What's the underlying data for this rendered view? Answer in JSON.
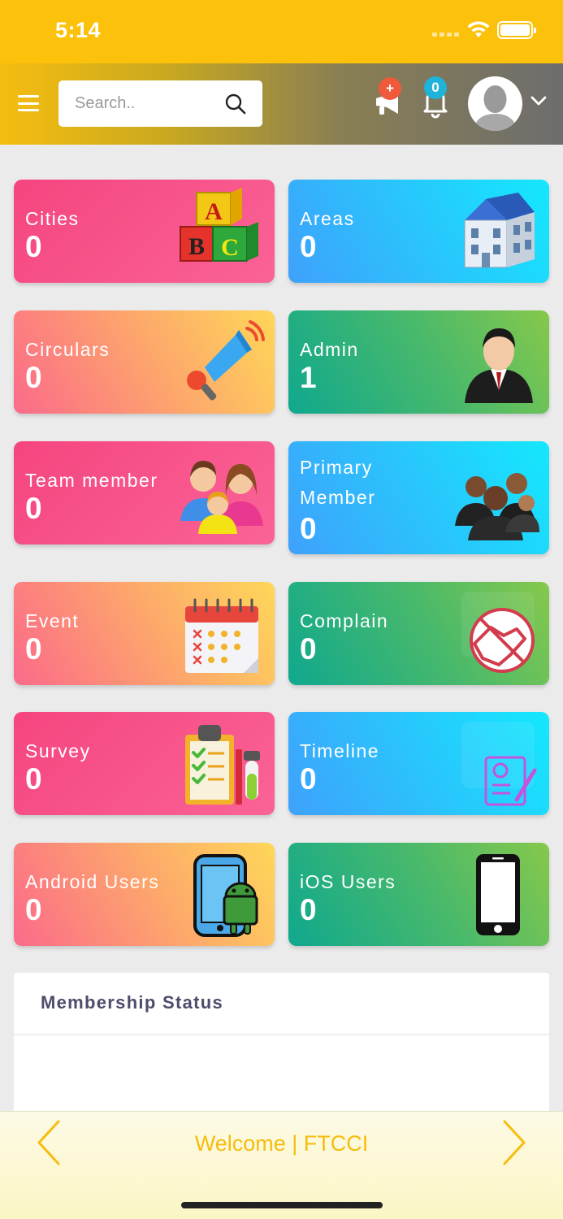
{
  "status_bar": {
    "time": "5:14"
  },
  "header": {
    "search_placeholder": "Search..",
    "announcement_badge": "+",
    "notification_count": "0"
  },
  "cards": [
    {
      "title": "Cities",
      "value": "0",
      "icon": "abc-blocks-icon"
    },
    {
      "title": "Areas",
      "value": "0",
      "icon": "building-icon"
    },
    {
      "title": "Circulars",
      "value": "0",
      "icon": "megaphone-icon"
    },
    {
      "title": "Admin",
      "value": "1",
      "icon": "businessman-icon"
    },
    {
      "title": "Team member",
      "value": "0",
      "icon": "family-icon"
    },
    {
      "title": "Primary Member",
      "value": "0",
      "icon": "group-icon"
    },
    {
      "title": "Event",
      "value": "0",
      "icon": "calendar-icon"
    },
    {
      "title": "Complain",
      "value": "0",
      "icon": "handshake-icon"
    },
    {
      "title": "Survey",
      "value": "0",
      "icon": "clipboard-checklist-icon"
    },
    {
      "title": "Timeline",
      "value": "0",
      "icon": "document-edit-icon"
    },
    {
      "title": "Android Users",
      "value": "0",
      "icon": "android-phone-icon"
    },
    {
      "title": "iOS Users",
      "value": "0",
      "icon": "iphone-icon"
    }
  ],
  "membership": {
    "title": "Membership Status"
  },
  "bottom_bar": {
    "welcome": "Welcome | FTCCI"
  },
  "colors": {
    "accent": "#fcc10a",
    "pink": "#f5457f",
    "blue": "#3fa1fc",
    "green": "#0fa88e"
  }
}
